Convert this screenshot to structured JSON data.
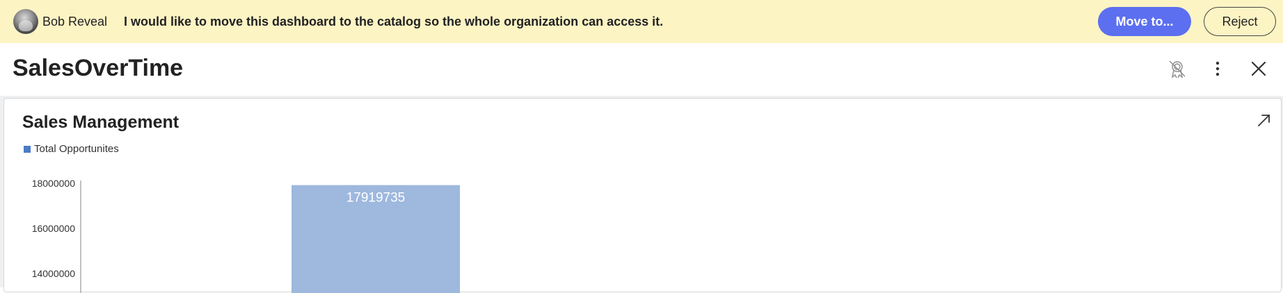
{
  "banner": {
    "user_name": "Bob Reveal",
    "message": "I would like to move this dashboard to the catalog so the whole organization can access it.",
    "move_label": "Move to...",
    "reject_label": "Reject"
  },
  "header": {
    "title": "SalesOverTime",
    "icons": [
      "certificate-off-icon",
      "more-vertical-icon",
      "close-icon"
    ]
  },
  "widget": {
    "title": "Sales Management",
    "expand_icon": "expand-icon"
  },
  "colors": {
    "banner_bg": "#fdf4c4",
    "accent": "#5c6ff0",
    "bar": "#9eb8de",
    "legend": "#4a7cc9"
  },
  "chart_data": {
    "type": "bar",
    "series": [
      {
        "name": "Total Opportunites",
        "values": [
          17919735
        ]
      }
    ],
    "categories": [
      ""
    ],
    "data_labels": [
      "17919735"
    ],
    "y_ticks": [
      "18000000",
      "16000000",
      "14000000"
    ],
    "y_tick_values": [
      18000000,
      16000000,
      14000000
    ],
    "legend_position": "top-left",
    "grid": false
  }
}
